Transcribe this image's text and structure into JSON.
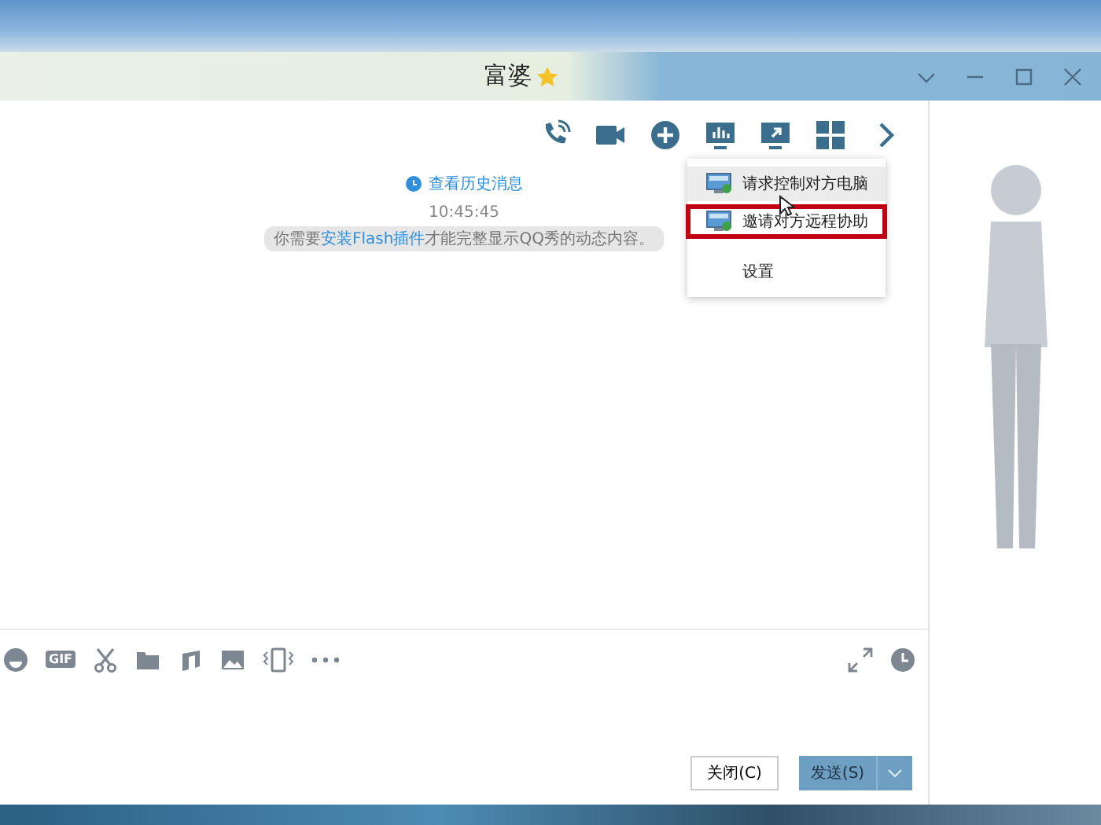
{
  "window": {
    "title": "富婆"
  },
  "chat": {
    "history_link": "查看历史消息",
    "time": "10:45:45",
    "notice": "你需要**安装Flash插件**才能完整显示QQ秀的动态内容。"
  },
  "menu": {
    "items": [
      {
        "kind": "remote",
        "label": "请求控制对方电脑",
        "selected": true,
        "highlighted": false
      },
      {
        "kind": "remote",
        "label": "邀请对方远程协助",
        "selected": false,
        "highlighted": true
      },
      {
        "kind": "plain",
        "label": "设置",
        "selected": false,
        "highlighted": false
      }
    ]
  },
  "input_toolbar": {
    "gif_label": "GIF"
  },
  "buttons": {
    "close": "关闭(C)",
    "send": "发送(S)"
  }
}
